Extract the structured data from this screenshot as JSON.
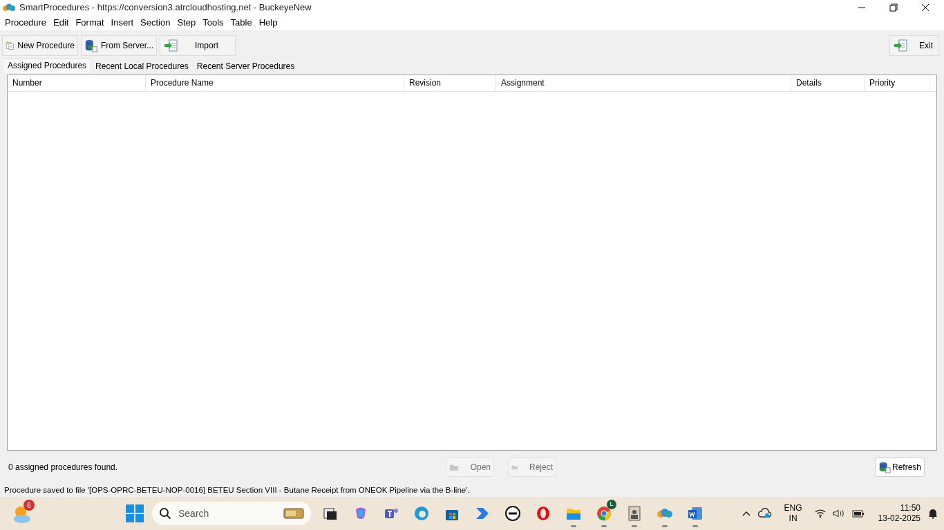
{
  "window": {
    "title": "SmartProcedures - https://conversion3.atrcloudhosting.net - BuckeyeNew"
  },
  "menu": [
    "Procedure",
    "Edit",
    "Format",
    "Insert",
    "Section",
    "Step",
    "Tools",
    "Table",
    "Help"
  ],
  "toolbar": [
    {
      "label": "New Procedure",
      "kind": "new"
    },
    {
      "label": "From Server...",
      "kind": "server"
    },
    {
      "label": "Import",
      "kind": "import"
    }
  ],
  "exit_button": {
    "label": "Exit"
  },
  "tabs": [
    {
      "label": "Assigned Procedures",
      "selected": true
    },
    {
      "label": "Recent Local Procedures",
      "selected": false
    },
    {
      "label": "Recent Server Procedures",
      "selected": false
    }
  ],
  "table": {
    "columns": [
      "Number",
      "Procedure Name",
      "Revision",
      "Assignment",
      "Details",
      "Priority"
    ]
  },
  "result_count": "0 assigned procedures found.",
  "actions": [
    {
      "label": "Open",
      "disabled": true
    },
    {
      "label": "Reject",
      "disabled": true
    }
  ],
  "refresh_button": {
    "label": "Refresh"
  },
  "status_bar": "Procedure saved to file '[OPS-OPRC-BETEU-NOP-0016] BETEU Section VIII - Butane Receipt from ONEOK Pipeline via the B-line'.",
  "taskbar": {
    "weather_badge": "6",
    "search": {
      "placeholder": "Search"
    },
    "apps": [
      {
        "kind": "taskview",
        "running": false
      },
      {
        "kind": "copilot",
        "running": false
      },
      {
        "kind": "teams",
        "running": false
      },
      {
        "kind": "edge",
        "running": false
      },
      {
        "kind": "store",
        "running": false
      },
      {
        "kind": "automate",
        "running": false
      },
      {
        "kind": "dell",
        "running": false
      },
      {
        "kind": "opera",
        "running": false
      },
      {
        "kind": "folder",
        "running": true
      },
      {
        "kind": "chrome",
        "running": true,
        "badge": "L"
      },
      {
        "kind": "portrait",
        "running": true
      },
      {
        "kind": "smartprocedures",
        "running": true
      },
      {
        "kind": "word",
        "running": true
      }
    ],
    "language": "ENG",
    "region": "IN",
    "time": "11:50",
    "date": "13-02-2025"
  }
}
